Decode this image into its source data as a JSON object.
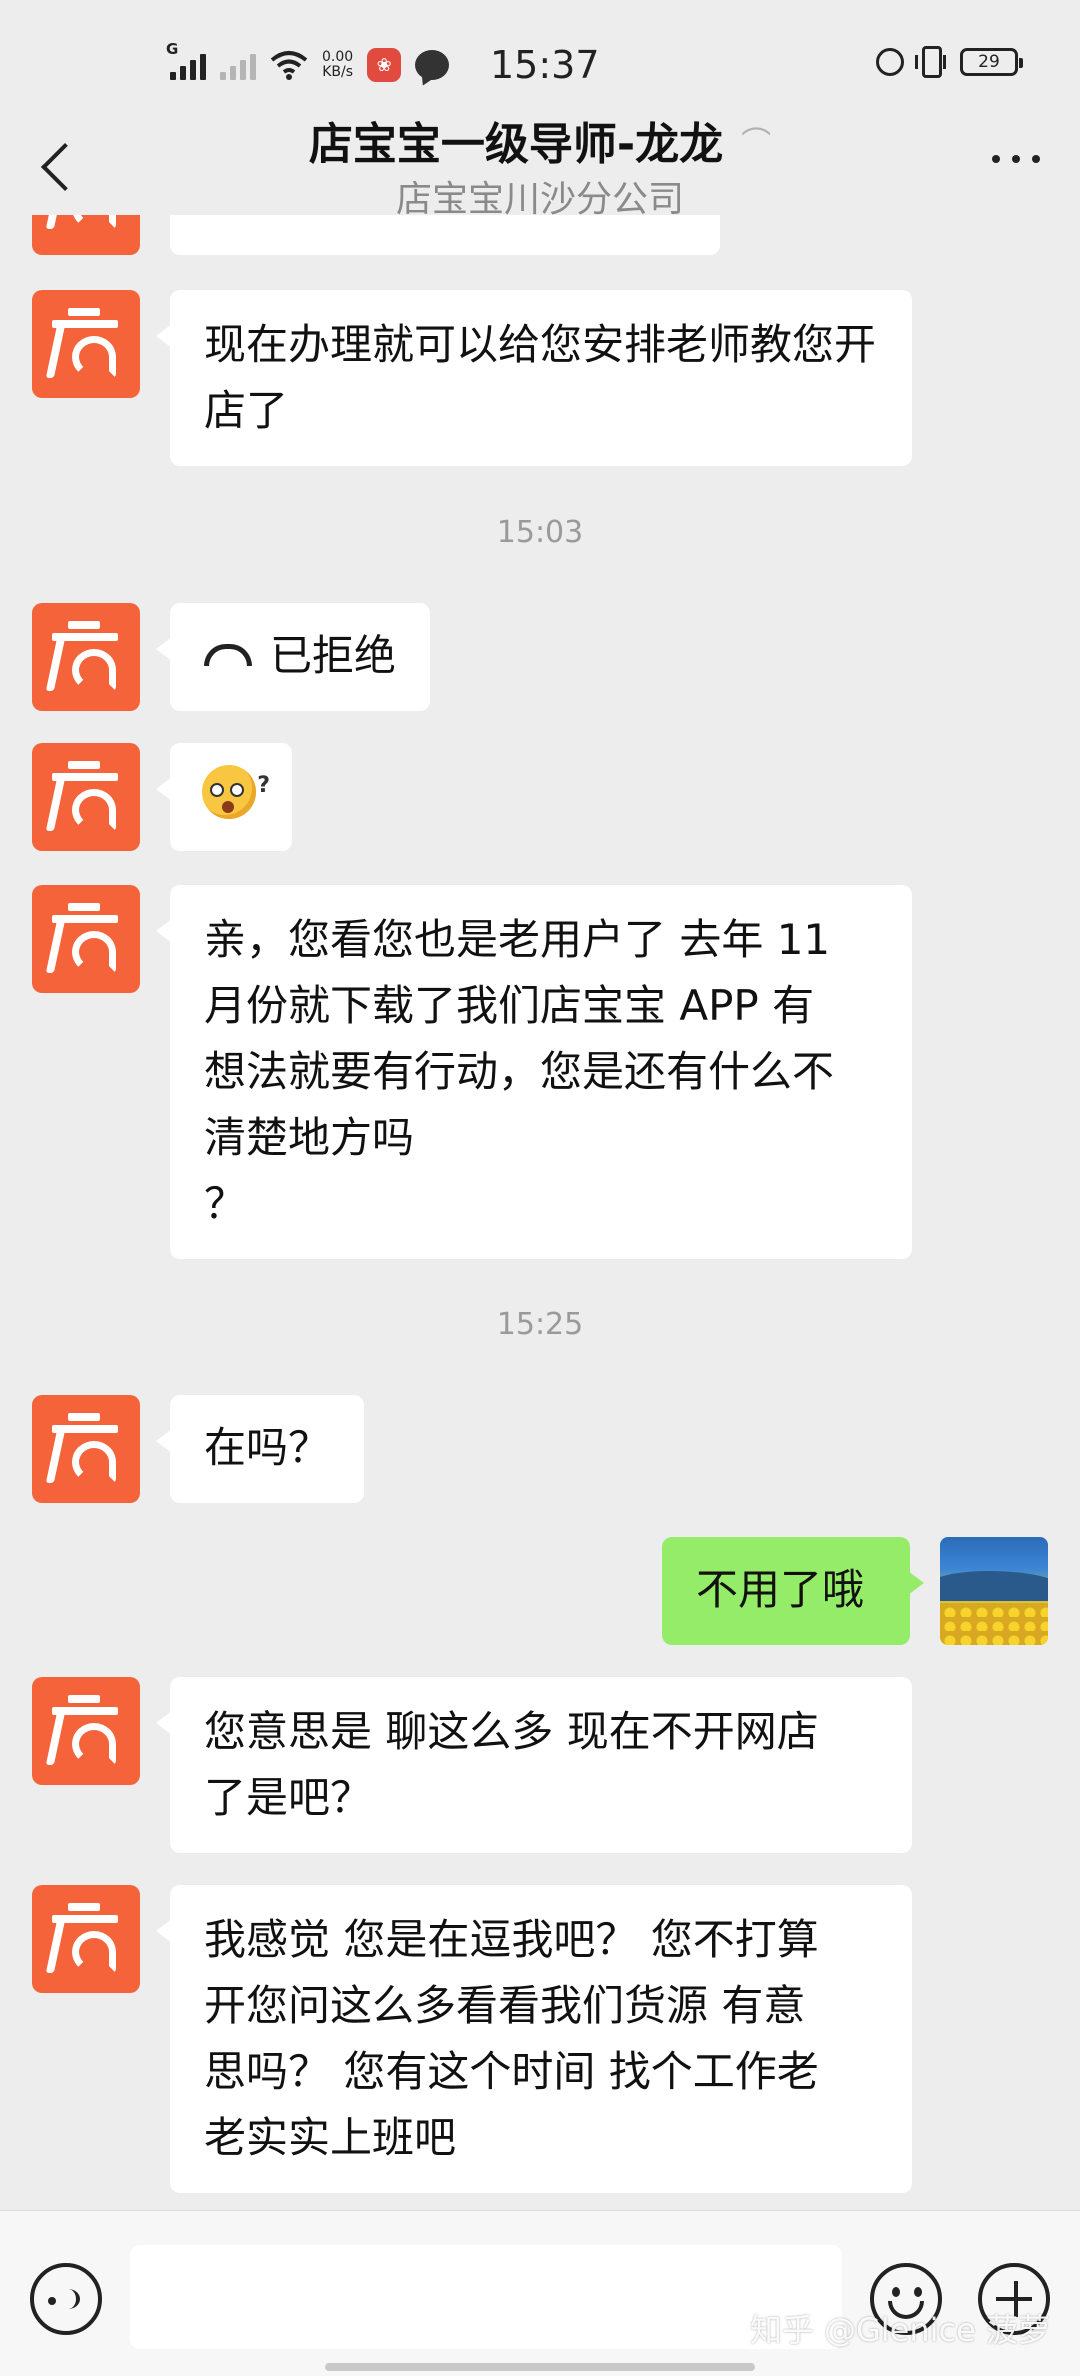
{
  "status_bar": {
    "network_label": "G",
    "speed_value": "0.00",
    "speed_unit": "KB/s",
    "time": "15:37",
    "battery": "29"
  },
  "header": {
    "title": "店宝宝一级导师-龙龙",
    "subtitle": "店宝宝川沙分公司"
  },
  "messages": {
    "m1": "现在办理就可以给您安排老师教您开店了",
    "ts1": "15:03",
    "m2_call": "已拒绝",
    "m4_line1": "亲，您看您也是老用户了 去年 11",
    "m4_line2": "月份就下载了我们店宝宝 APP 有",
    "m4_line3": "想法就要有行动，您是还有什么不",
    "m4_line4": "清楚地方吗",
    "m4_line5": "？",
    "ts2": "15:25",
    "m5": "在吗？",
    "m6_me": "不用了哦",
    "m7_line1": "您意思是 聊这么多 现在不开网店",
    "m7_line2": "了是吧？",
    "m8_line1": "我感觉 您是在逗我吧？ 您不打算",
    "m8_line2": "开您问这么多看看我们货源 有意",
    "m8_line3": "思吗？ 您有这个时间 找个工作老",
    "m8_line4": "老实实上班吧"
  },
  "watermark": "知乎 @Glenice 菠萝",
  "colors": {
    "background": "#ededed",
    "avatar_orange": "#f4633a",
    "my_bubble": "#95ec69"
  },
  "icons": [
    "back-icon",
    "ear-icon",
    "more-icon",
    "decline-call-icon",
    "voice-icon",
    "emoji-icon",
    "plus-icon"
  ]
}
